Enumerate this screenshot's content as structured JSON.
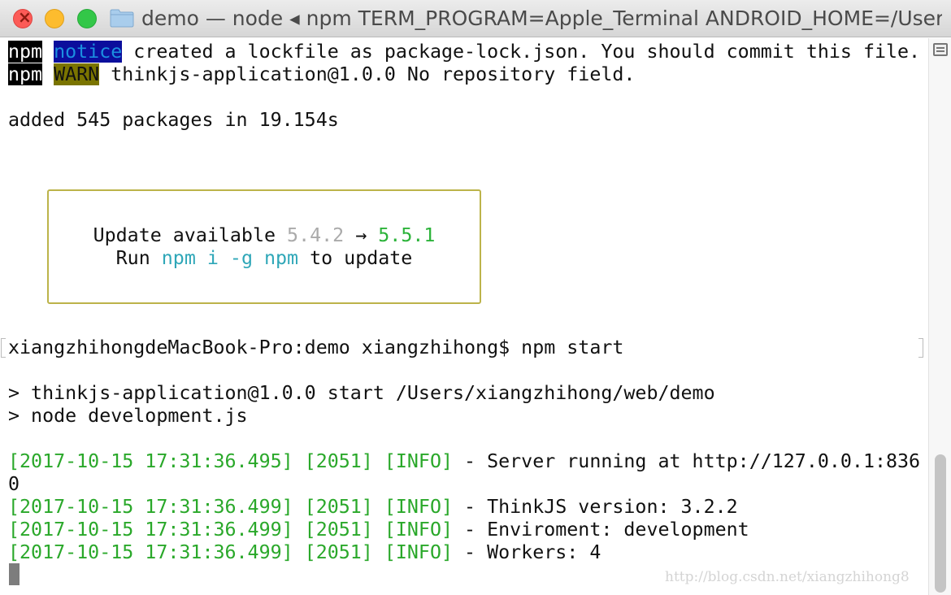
{
  "window": {
    "title": "demo — node ◂ npm TERM_PROGRAM=Apple_Terminal ANDROID_HOME=/Users/..."
  },
  "icons": [
    "close-icon",
    "minimize-icon",
    "maximize-icon",
    "folder-icon",
    "scroll-menu-icon"
  ],
  "terminal": {
    "lines": {
      "notice": {
        "npm": "npm",
        "tag": "notice",
        "text": " created a lockfile as package-lock.json. You should commit this file."
      },
      "warn": {
        "npm": "npm",
        "tag": "WARN",
        "text": " thinkjs-application@1.0.0 No repository field."
      },
      "added": "added 545 packages in 19.154s",
      "update_box": {
        "line1_prefix": "Update available ",
        "old_version": "5.4.2",
        "arrow": " → ",
        "new_version": "5.5.1",
        "line2_prefix": "Run ",
        "command": "npm i -g npm",
        "line2_suffix": " to update"
      },
      "prompt": "xiangzhihongdeMacBook-Pro:demo xiangzhihong$ npm start",
      "script1": "> thinkjs-application@1.0.0 start /Users/xiangzhihong/web/demo",
      "script2": "> node development.js",
      "logs": [
        {
          "prefix": "[2017-10-15 17:31:36.495] [2051] [INFO]",
          "message": " - Server running at http://127.0.0.1:836"
        },
        {
          "prefix": "",
          "message": "0"
        },
        {
          "prefix": "[2017-10-15 17:31:36.499] [2051] [INFO]",
          "message": " - ThinkJS version: 3.2.2"
        },
        {
          "prefix": "[2017-10-15 17:31:36.499] [2051] [INFO]",
          "message": " - Enviroment: development"
        },
        {
          "prefix": "[2017-10-15 17:31:36.499] [2051] [INFO]",
          "message": " - Workers: 4"
        }
      ]
    },
    "watermark": "http://blog.csdn.net/xiangzhihong8"
  },
  "colors": {
    "log_green": "#2aa82a",
    "update_new": "#2cb33a",
    "update_old": "#aaaaaa",
    "update_cmd": "#2fa7b8",
    "box_border": "#bcb34a"
  }
}
